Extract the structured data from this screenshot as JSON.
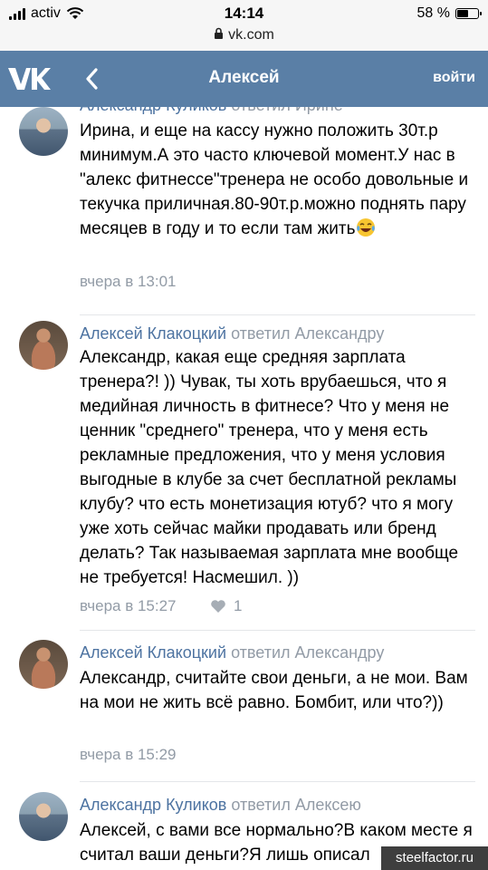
{
  "status_bar": {
    "carrier": "activ",
    "time": "14:14",
    "battery_percent": "58 %",
    "battery_level": 0.58
  },
  "browser": {
    "url": "vk.com"
  },
  "header": {
    "title": "Алексей",
    "login_label": "войти"
  },
  "comments": [
    {
      "author": "Александр Куликов",
      "reply_to": "ответил Ирине",
      "text": "Ирина, и еще на кассу нужно положить 30т.р минимум.А это часто ключевой момент.У нас в \"алекс фитнессе\"тренера не особо довольные и текучка приличная.80-90т.р.можно поднять пару месяцев в году и то если там жить",
      "emoji": "face-with-tears-of-joy",
      "time": "вчера в 13:01"
    },
    {
      "author": "Алексей Клакоцкий",
      "reply_to": "ответил Александру",
      "text": "Александр, какая еще средняя зарплата тренера?! )) Чувак, ты хоть врубаешься, что я медийная личность в фитнесе? Что у меня не ценник \"среднего\" тренера, что у меня есть рекламные предложения, что у меня условия выгодные в клубе за счет бесплатной рекламы клубу? что есть монетизация ютуб? что я могу уже хоть сейчас майки продавать или бренд делать? Так называемая зарплата мне вообще не требуется! Насмешил. ))",
      "time": "вчера в 15:27",
      "likes": "1"
    },
    {
      "author": "Алексей Клакоцкий",
      "reply_to": "ответил Александру",
      "text": "Александр, считайте свои деньги, а не мои. Вам на мои не жить всё равно. Бомбит, или что?))",
      "time": "вчера в 15:29"
    },
    {
      "author": "Александр Куликов",
      "reply_to": "ответил Алексею",
      "text": "Алексей, с вами все нормально?В каком месте я считал ваши деньги?Я лишь описал"
    }
  ],
  "watermark": "steelfactor.ru",
  "colors": {
    "header_bg": "#5a7fa6",
    "author_link": "#4d73a1",
    "meta_text": "#929ba6"
  }
}
